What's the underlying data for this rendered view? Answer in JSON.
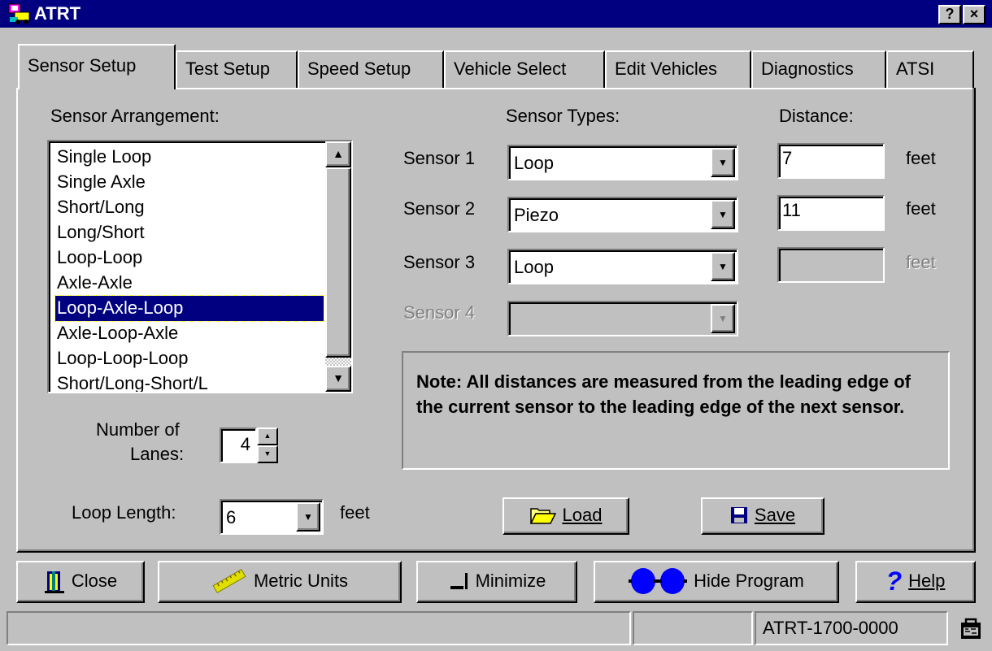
{
  "window": {
    "title": "ATRT",
    "help_button": "?",
    "close_button": "×"
  },
  "tabs": [
    {
      "label": "Sensor Setup",
      "active": true
    },
    {
      "label": "Test Setup"
    },
    {
      "label": "Speed Setup"
    },
    {
      "label": "Vehicle Select"
    },
    {
      "label": "Edit Vehicles"
    },
    {
      "label": "Diagnostics"
    },
    {
      "label": "ATSI"
    }
  ],
  "sensor_setup": {
    "arrangement_label": "Sensor Arrangement:",
    "arrangement_items": [
      "Single Loop",
      "Single Axle",
      "Short/Long",
      "Long/Short",
      "Loop-Loop",
      "Axle-Axle",
      "Loop-Axle-Loop",
      "Axle-Loop-Axle",
      "Loop-Loop-Loop",
      "Short/Long-Short/L"
    ],
    "arrangement_selected": "Loop-Axle-Loop",
    "lanes_label_line1": "Number of",
    "lanes_label_line2": "Lanes:",
    "lanes_value": "4",
    "loop_length_label": "Loop Length:",
    "loop_length_value": "6",
    "loop_length_unit": "feet",
    "types_header": "Sensor Types:",
    "distance_header": "Distance:",
    "sensors": [
      {
        "label": "Sensor 1",
        "type": "Loop",
        "distance": "7",
        "unit": "feet",
        "enabled": true
      },
      {
        "label": "Sensor 2",
        "type": "Piezo",
        "distance": "11",
        "unit": "feet",
        "enabled": true
      },
      {
        "label": "Sensor 3",
        "type": "Loop",
        "distance": "",
        "unit": "feet",
        "enabled": true
      },
      {
        "label": "Sensor 4",
        "type": "",
        "enabled": false
      }
    ],
    "note": "Note:  All distances are measured from the leading edge of the current sensor to the leading edge of the next sensor.",
    "load_label": "Load",
    "save_label": "Save"
  },
  "bottom_buttons": {
    "close": "Close",
    "metric": "Metric Units",
    "minimize": "Minimize",
    "hide": "Hide Program",
    "help": "Help"
  },
  "status_bar": {
    "pane1": "",
    "pane2": "",
    "device_id": "ATRT-1700-0000"
  },
  "colors": {
    "face": "#c0c0c0",
    "title_bar": "#000080",
    "selection": "#000080"
  }
}
